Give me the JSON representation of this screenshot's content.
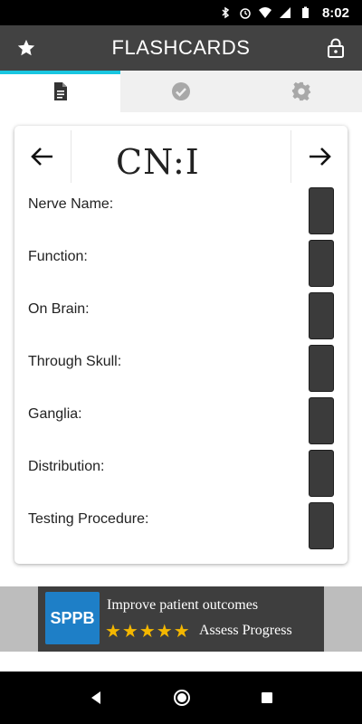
{
  "status_bar": {
    "time": "8:02"
  },
  "app_bar": {
    "title": "FLASHCARDS"
  },
  "tabs": [
    {
      "name": "document",
      "active": true
    },
    {
      "name": "check",
      "active": false
    },
    {
      "name": "settings",
      "active": false
    }
  ],
  "card": {
    "title": "CN:I",
    "fields": [
      {
        "label": "Nerve Name:"
      },
      {
        "label": "Function:"
      },
      {
        "label": "On Brain:"
      },
      {
        "label": "Through Skull:"
      },
      {
        "label": "Ganglia:"
      },
      {
        "label": "Distribution:"
      },
      {
        "label": "Testing Procedure:"
      }
    ]
  },
  "ad": {
    "logo_text": "SPPB",
    "headline": "Improve patient outcomes",
    "stars": "★★★★★",
    "subline": "Assess Progress"
  },
  "colors": {
    "accent": "#19c6e0",
    "app_bar": "#424242",
    "reveal_box": "#3b3b3b"
  }
}
